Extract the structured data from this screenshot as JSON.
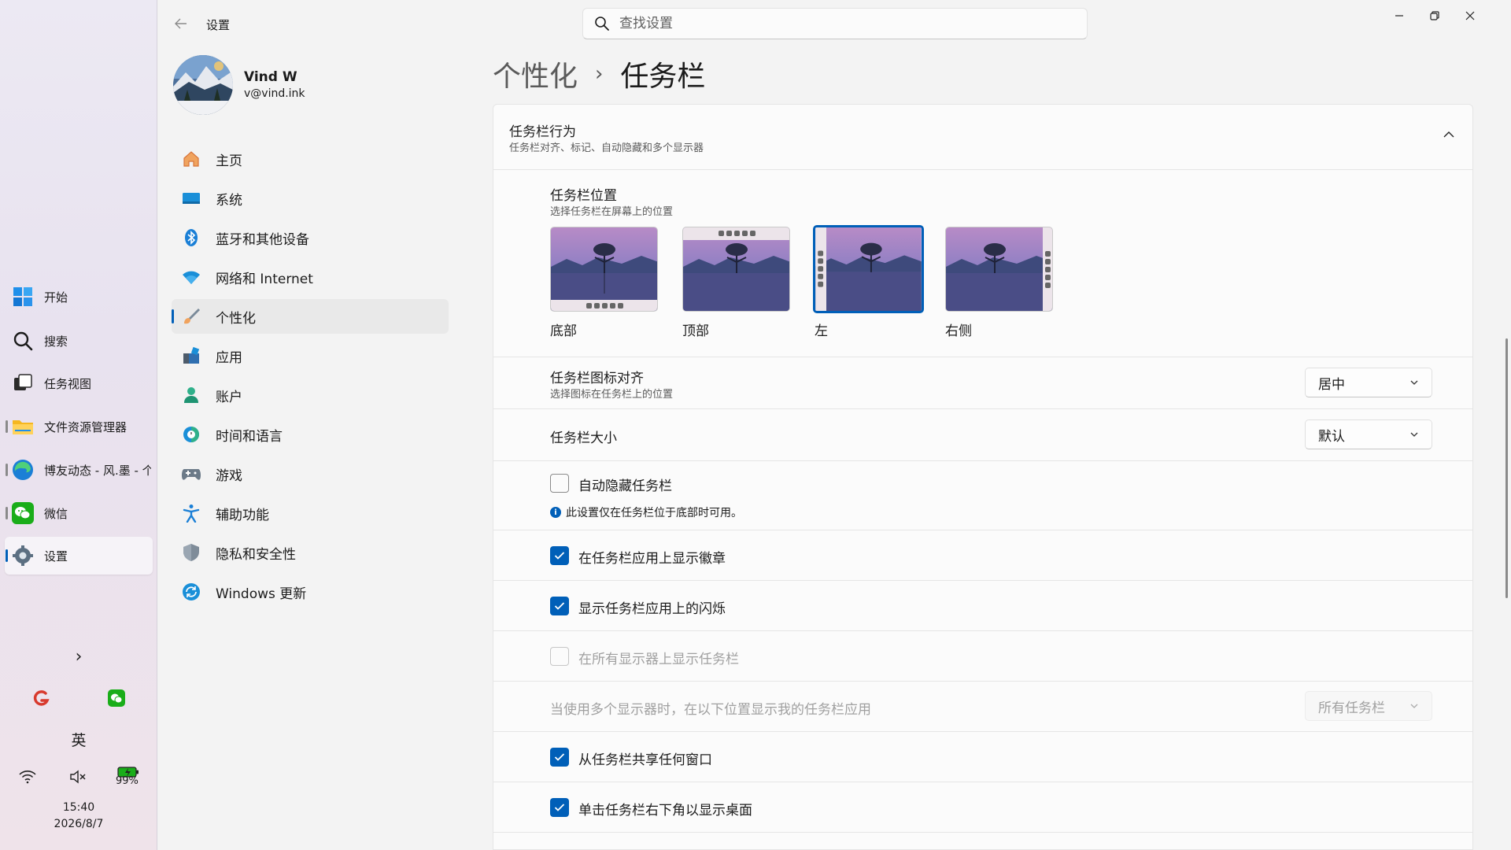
{
  "taskbar": {
    "items": [
      {
        "label": "开始",
        "icon": "windows-start-icon"
      },
      {
        "label": "搜索",
        "icon": "search-icon"
      },
      {
        "label": "任务视图",
        "icon": "task-view-icon"
      },
      {
        "label": "文件资源管理器",
        "icon": "file-explorer-icon"
      },
      {
        "label": "博友动态 - 风.墨 - 个",
        "icon": "edge-browser-icon"
      },
      {
        "label": "微信",
        "icon": "wechat-icon"
      },
      {
        "label": "设置",
        "icon": "settings-gear-icon"
      }
    ],
    "tray": {
      "ime": "英",
      "battery": "99%",
      "time": "15:40",
      "date": "2026/8/7"
    }
  },
  "window": {
    "app_title": "设置",
    "search_placeholder": "查找设置"
  },
  "profile": {
    "name": "Vind W",
    "email": "v@vind.ink"
  },
  "nav": [
    {
      "label": "主页",
      "icon": "home-icon"
    },
    {
      "label": "系统",
      "icon": "system-display-icon"
    },
    {
      "label": "蓝牙和其他设备",
      "icon": "bluetooth-icon"
    },
    {
      "label": "网络和 Internet",
      "icon": "wifi-icon"
    },
    {
      "label": "个性化",
      "icon": "paint-brush-icon",
      "active": true
    },
    {
      "label": "应用",
      "icon": "apps-icon"
    },
    {
      "label": "账户",
      "icon": "account-icon"
    },
    {
      "label": "时间和语言",
      "icon": "time-language-icon"
    },
    {
      "label": "游戏",
      "icon": "gamepad-icon"
    },
    {
      "label": "辅助功能",
      "icon": "accessibility-icon"
    },
    {
      "label": "隐私和安全性",
      "icon": "shield-icon"
    },
    {
      "label": "Windows 更新",
      "icon": "windows-update-icon"
    }
  ],
  "breadcrumb": {
    "parent": "个性化",
    "separator": "›",
    "current": "任务栏"
  },
  "behaviors": {
    "title": "任务栏行为",
    "subtitle": "任务栏对齐、标记、自动隐藏和多个显示器",
    "position": {
      "title": "任务栏位置",
      "subtitle": "选择任务栏在屏幕上的位置",
      "options": [
        {
          "label": "底部",
          "selected": false
        },
        {
          "label": "顶部",
          "selected": false
        },
        {
          "label": "左",
          "selected": true
        },
        {
          "label": "右侧",
          "selected": false
        }
      ]
    },
    "alignment": {
      "title": "任务栏图标对齐",
      "subtitle": "选择图标在任务栏上的位置",
      "value": "居中"
    },
    "size": {
      "title": "任务栏大小",
      "value": "默认"
    },
    "auto_hide": {
      "label": "自动隐藏任务栏",
      "checked": false,
      "info": "此设置仅在任务栏位于底部时可用。"
    },
    "badges": {
      "label": "在任务栏应用上显示徽章",
      "checked": true
    },
    "flashing": {
      "label": "显示任务栏应用上的闪烁",
      "checked": true
    },
    "all_displays": {
      "label": "在所有显示器上显示任务栏",
      "checked": false,
      "disabled": true
    },
    "multi_display": {
      "title": "当使用多个显示器时，在以下位置显示我的任务栏应用",
      "value": "所有任务栏",
      "disabled": true
    },
    "share_window": {
      "label": "从任务栏共享任何窗口",
      "checked": true
    },
    "show_desktop": {
      "label": "单击任务栏右下角以显示桌面",
      "checked": true
    }
  },
  "colors": {
    "accent": "#005fb8"
  }
}
